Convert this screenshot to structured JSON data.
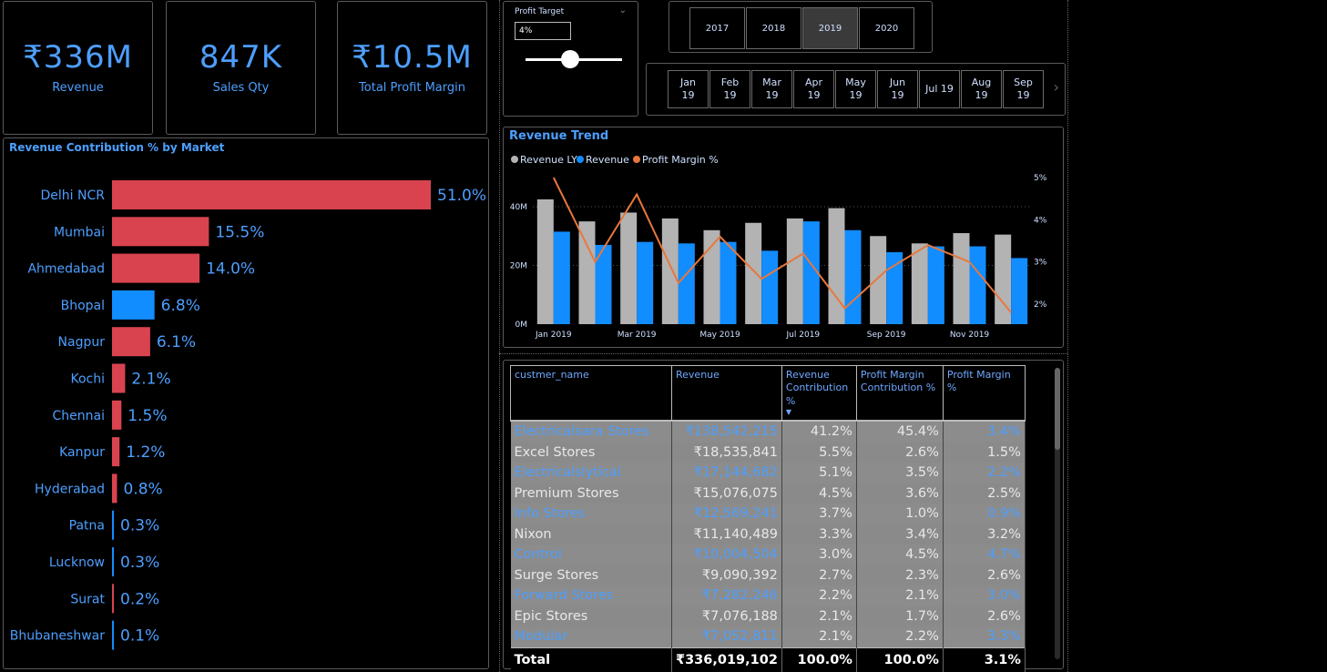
{
  "kpis": [
    {
      "value": "₹336M",
      "label": "Revenue"
    },
    {
      "value": "847K",
      "label": "Sales Qty"
    },
    {
      "value": "₹10.5M",
      "label": "Total Profit Margin"
    }
  ],
  "slicer": {
    "title": "Profit Target",
    "value": "4%"
  },
  "years": {
    "items": [
      "2017",
      "2018",
      "2019",
      "2020"
    ],
    "selected": "2019"
  },
  "months": [
    "Jan\n19",
    "Feb\n19",
    "Mar\n19",
    "Apr\n19",
    "May\n19",
    "Jun\n19",
    "Jul 19",
    "Aug\n19",
    "Sep\n19"
  ],
  "colors": {
    "accent": "#4d9fff",
    "bar_red": "#d9434f",
    "bar_blue": "#118dff",
    "revenue_ly": "#b3b3b3",
    "profit_line": "#e8773d"
  },
  "market_chart": {
    "title": "Revenue Contribution % by Market",
    "chart_data": {
      "type": "bar",
      "orientation": "horizontal",
      "categories": [
        "Delhi NCR",
        "Mumbai",
        "Ahmedabad",
        "Bhopal",
        "Nagpur",
        "Kochi",
        "Chennai",
        "Kanpur",
        "Hyderabad",
        "Patna",
        "Lucknow",
        "Surat",
        "Bhubaneshwar"
      ],
      "values": [
        51.0,
        15.5,
        14.0,
        6.8,
        6.1,
        2.1,
        1.5,
        1.2,
        0.8,
        0.3,
        0.3,
        0.2,
        0.1
      ],
      "labels": [
        "51.0%",
        "15.5%",
        "14.0%",
        "6.8%",
        "6.1%",
        "2.1%",
        "1.5%",
        "1.2%",
        "0.8%",
        "0.3%",
        "0.3%",
        "0.2%",
        "0.1%"
      ],
      "highlight_colors": [
        "red",
        "red",
        "red",
        "blue",
        "red",
        "red",
        "red",
        "red",
        "red",
        "blue",
        "blue",
        "red",
        "blue"
      ],
      "xlim": [
        0,
        51
      ]
    }
  },
  "trend_chart": {
    "title": "Revenue Trend",
    "chart_data": {
      "type": "bar",
      "categories": [
        "Jan 2019",
        "Feb 2019",
        "Mar 2019",
        "Apr 2019",
        "May 2019",
        "Jun 2019",
        "Jul 2019",
        "Aug 2019",
        "Sep 2019",
        "Oct 2019",
        "Nov 2019",
        "Dec 2019"
      ],
      "x_tick_labels": [
        "Jan 2019",
        "Mar 2019",
        "May 2019",
        "Jul 2019",
        "Sep 2019",
        "Nov 2019"
      ],
      "series": [
        {
          "name": "Revenue LY",
          "values": [
            42.5,
            35,
            38,
            36,
            32,
            34.5,
            36,
            39.5,
            30,
            27.5,
            31,
            30.5
          ],
          "axis": "left"
        },
        {
          "name": "Revenue",
          "values": [
            31.5,
            27,
            28,
            27.5,
            28,
            25,
            35,
            32,
            24.5,
            26.5,
            26.5,
            22.5
          ],
          "axis": "left"
        },
        {
          "name": "Profit Margin %",
          "type": "line",
          "values": [
            5.0,
            3.0,
            4.6,
            2.5,
            3.6,
            2.6,
            3.2,
            1.9,
            2.8,
            3.4,
            3.0,
            1.8
          ],
          "axis": "right"
        }
      ],
      "y_left": {
        "ticks": [
          "0M",
          "20M",
          "40M"
        ],
        "ylim": [
          0,
          40
        ]
      },
      "y_right": {
        "ticks": [
          "2%",
          "3%",
          "4%",
          "5%"
        ],
        "ylim": [
          1.5,
          5.0
        ]
      },
      "grid": true,
      "legend_position": "top-left"
    }
  },
  "table": {
    "columns": [
      "custmer_name",
      "Revenue",
      "Revenue Contribution %",
      "Profit Margin Contribution %",
      "Profit Margin %"
    ],
    "sort_indicator": "▼",
    "rows": [
      [
        "Electricalsara Stores",
        "₹138,542,215",
        "41.2%",
        "45.4%",
        "3.4%"
      ],
      [
        "Excel Stores",
        "₹18,535,841",
        "5.5%",
        "2.6%",
        "1.5%"
      ],
      [
        "Electricalslytical",
        "₹17,144,682",
        "5.1%",
        "3.5%",
        "2.2%"
      ],
      [
        "Premium Stores",
        "₹15,076,075",
        "4.5%",
        "3.6%",
        "2.5%"
      ],
      [
        "Info Stores",
        "₹12,569,241",
        "3.7%",
        "1.0%",
        "0.9%"
      ],
      [
        "Nixon",
        "₹11,140,489",
        "3.3%",
        "3.4%",
        "3.2%"
      ],
      [
        "Control",
        "₹10,004,504",
        "3.0%",
        "4.5%",
        "4.7%"
      ],
      [
        "Surge Stores",
        "₹9,090,392",
        "2.7%",
        "2.3%",
        "2.6%"
      ],
      [
        "Forward Stores",
        "₹7,282,246",
        "2.2%",
        "2.1%",
        "3.0%"
      ],
      [
        "Epic Stores",
        "₹7,076,188",
        "2.1%",
        "1.7%",
        "2.6%"
      ],
      [
        "Modular",
        "₹7,052,811",
        "2.1%",
        "2.2%",
        "3.3%"
      ]
    ],
    "total": [
      "Total",
      "₹336,019,102",
      "100.0%",
      "100.0%",
      "3.1%"
    ]
  }
}
